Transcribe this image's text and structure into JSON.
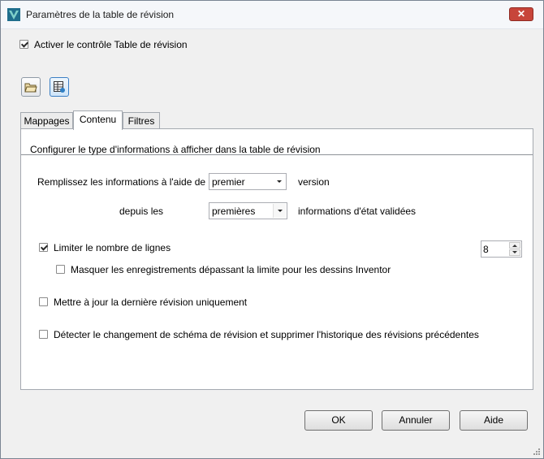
{
  "window": {
    "title": "Paramètres de la table de révision",
    "close_label": "✕"
  },
  "enable": {
    "label": "Activer le contrôle Table de révision",
    "checked": true
  },
  "toolbar": {
    "open_icon": "folder-open-icon",
    "table_icon": "table-settings-icon"
  },
  "tabs": [
    {
      "label": "Mappages",
      "active": false
    },
    {
      "label": "Contenu",
      "active": true
    },
    {
      "label": "Filtres",
      "active": false
    }
  ],
  "content": {
    "header": "Configurer le type d'informations à afficher dans la table de révision",
    "fill_label": "Remplissez les informations à l'aide de",
    "fill_value": "premier",
    "fill_suffix": "version",
    "from_label": "depuis les",
    "from_value": "premières",
    "from_suffix": "informations d'état validées",
    "limit_label": "Limiter le nombre de lignes",
    "limit_checked": true,
    "limit_value": "8",
    "hide_label": "Masquer les enregistrements dépassant la limite pour les dessins Inventor",
    "hide_checked": false,
    "update_label": "Mettre à jour la dernière révision uniquement",
    "update_checked": false,
    "detect_label": "Détecter le changement de schéma de révision et supprimer l'historique des révisions précédentes",
    "detect_checked": false
  },
  "buttons": {
    "ok": "OK",
    "cancel": "Annuler",
    "help": "Aide"
  }
}
